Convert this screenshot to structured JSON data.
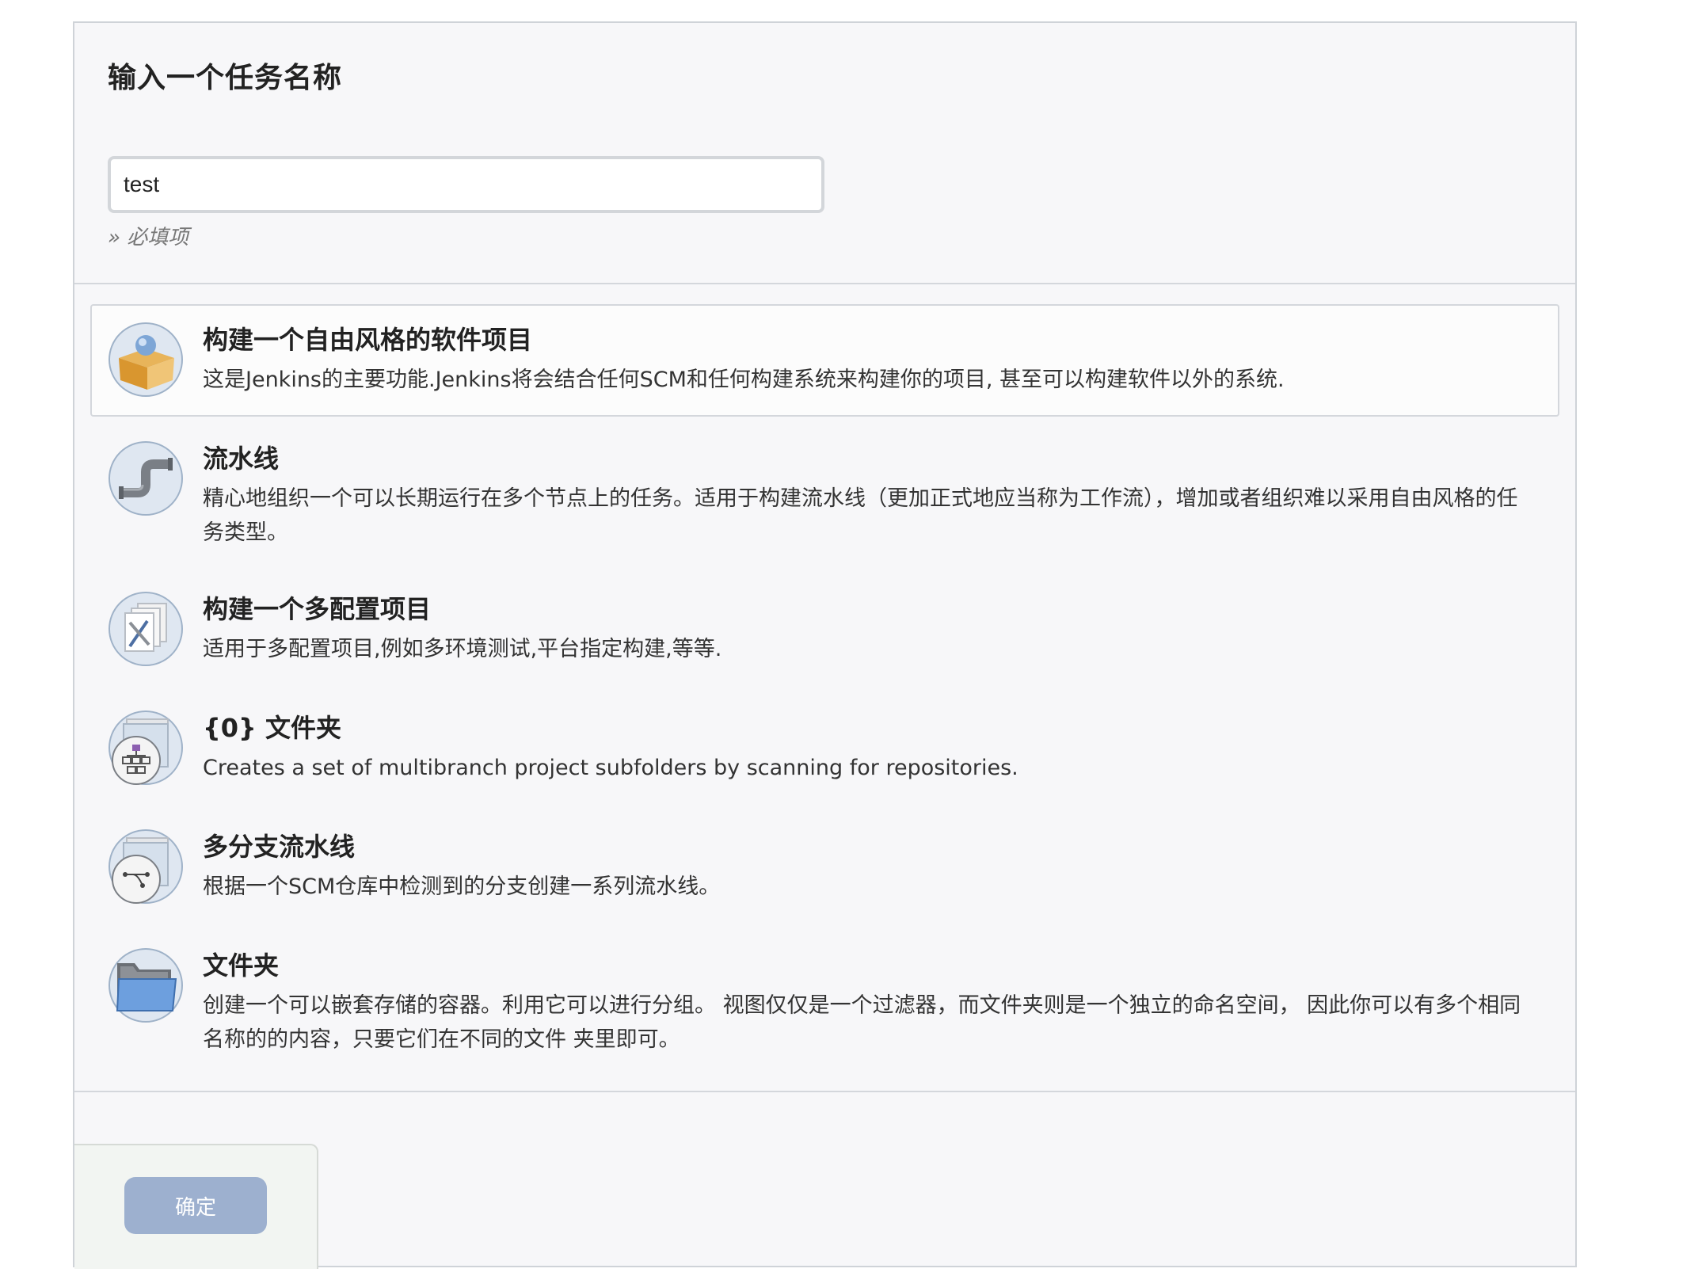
{
  "header": {
    "title": "输入一个任务名称",
    "name_input_value": "test",
    "required_hint": "» 必填项"
  },
  "job_types": [
    {
      "icon": "freestyle-box-icon",
      "title": "构建一个自由风格的软件项目",
      "description": "这是Jenkins的主要功能.Jenkins将会结合任何SCM和任何构建系统来构建你的项目, 甚至可以构建软件以外的系统.",
      "selected": true
    },
    {
      "icon": "pipeline-pipe-icon",
      "title": "流水线",
      "description": "精心地组织一个可以长期运行在多个节点上的任务。适用于构建流水线（更加正式地应当称为工作流），增加或者组织难以采用自由风格的任务类型。",
      "selected": false
    },
    {
      "icon": "multi-config-tools-icon",
      "title": "构建一个多配置项目",
      "description": "适用于多配置项目,例如多环境测试,平台指定构建,等等.",
      "selected": false
    },
    {
      "icon": "org-folder-icon",
      "title": "{0} 文件夹",
      "description": "Creates a set of multibranch project subfolders by scanning for repositories.",
      "selected": false
    },
    {
      "icon": "multibranch-pipeline-icon",
      "title": "多分支流水线",
      "description": "根据一个SCM仓库中检测到的分支创建一系列流水线。",
      "selected": false
    },
    {
      "icon": "folder-icon",
      "title": "文件夹",
      "description": "创建一个可以嵌套存储的容器。利用它可以进行分组。 视图仅仅是一个过滤器，而文件夹则是一个独立的命名空间， 因此你可以有多个相同名称的的内容，只要它们在不同的文件 夹里即可。",
      "selected": false
    }
  ],
  "footer": {
    "ok_label": "确定"
  },
  "colors": {
    "panel_bg": "#f7f7f9",
    "ok_button_bg": "#9db0cf",
    "icon_circle_bg": "#dfe7f1"
  }
}
